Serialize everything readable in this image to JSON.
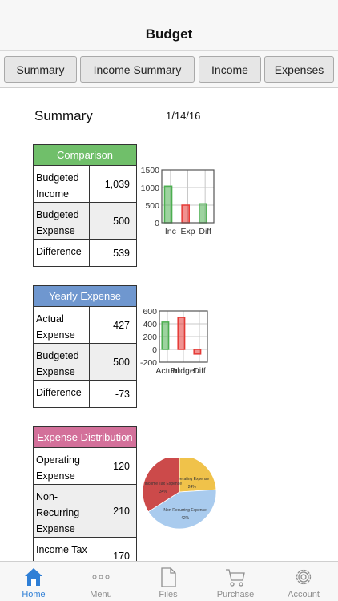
{
  "nav": {
    "title": "Budget"
  },
  "segments": [
    "Summary",
    "Income Summary",
    "Income",
    "Expenses"
  ],
  "summary": {
    "title": "Summary",
    "date": "1/14/16"
  },
  "comparison": {
    "header": "Comparison",
    "header_color": "#70bf6a",
    "rows": [
      {
        "label": "Budgeted Income",
        "value": "1,039"
      },
      {
        "label": "Budgeted Expense",
        "value": "500"
      },
      {
        "label": "Difference",
        "value": "539"
      }
    ],
    "chart": {
      "type": "bar",
      "categories": [
        "Inc",
        "Exp",
        "Diff"
      ],
      "values": [
        1039,
        500,
        539
      ],
      "colors": [
        "#4caf50",
        "#e53935",
        "#4caf50"
      ],
      "ylim": [
        0,
        1500
      ],
      "yticks": [
        "1500",
        "1000",
        "500",
        "0"
      ],
      "grid": true
    }
  },
  "yearly": {
    "header": "Yearly Expense",
    "header_color": "#6f97cf",
    "rows": [
      {
        "label": "Actual Expense",
        "value": "427"
      },
      {
        "label": "Budgeted Expense",
        "value": "500"
      },
      {
        "label": "Difference",
        "value": "-73"
      }
    ],
    "chart": {
      "type": "bar",
      "categories": [
        "Actual",
        "Budget",
        "Diff"
      ],
      "values": [
        427,
        500,
        -73
      ],
      "colors": [
        "#4caf50",
        "#e53935",
        "#e53935"
      ],
      "ylim": [
        -200,
        600
      ],
      "yticks": [
        "600",
        "400",
        "200",
        "0",
        "-200"
      ],
      "grid": true
    }
  },
  "distribution": {
    "header": "Expense Distribution",
    "header_color": "#d3709a",
    "rows": [
      {
        "label": "Operating Expense",
        "value": "120"
      },
      {
        "label": "Non-Recurring Expense",
        "value": "210"
      },
      {
        "label": "Income Tax Expense",
        "value": "170"
      }
    ],
    "chart": {
      "type": "pie",
      "slices": [
        {
          "label": "Operating Expense",
          "value": 24,
          "pct": "24%",
          "color": "#f0c24a"
        },
        {
          "label": "Non-Recurring Expense",
          "value": 42,
          "pct": "42%",
          "color": "#a9cbee"
        },
        {
          "label": "Income Tax Expense",
          "value": 34,
          "pct": "34%",
          "color": "#cc4a4a"
        }
      ]
    }
  },
  "tabs": [
    {
      "label": "Home",
      "icon": "home-icon",
      "active": true
    },
    {
      "label": "Menu",
      "icon": "more-icon",
      "active": false
    },
    {
      "label": "Files",
      "icon": "file-icon",
      "active": false
    },
    {
      "label": "Purchase",
      "icon": "cart-icon",
      "active": false
    },
    {
      "label": "Account",
      "icon": "gear-icon",
      "active": false
    }
  ],
  "accent_color": "#2f7fd6"
}
